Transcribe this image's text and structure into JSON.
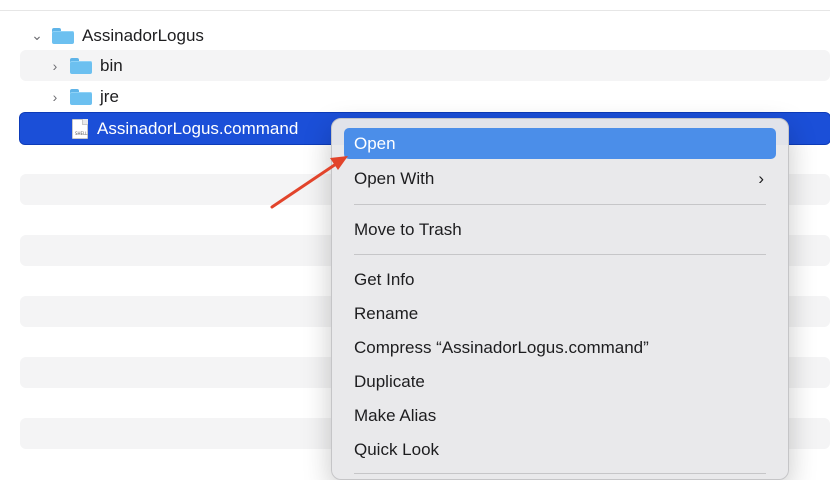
{
  "finder": {
    "root": {
      "name": "AssinadorLogus",
      "expanded": true
    },
    "items": [
      {
        "name": "bin",
        "kind": "folder"
      },
      {
        "name": "jre",
        "kind": "folder"
      },
      {
        "name": "AssinadorLogus.command",
        "kind": "file",
        "selected": true,
        "icon_tag": "SHELL"
      }
    ]
  },
  "context_menu": {
    "open": "Open",
    "open_with": "Open With",
    "open_with_chevron": "›",
    "move_to_trash": "Move to Trash",
    "get_info": "Get Info",
    "rename": "Rename",
    "compress": "Compress “AssinadorLogus.command”",
    "duplicate": "Duplicate",
    "make_alias": "Make Alias",
    "quick_look": "Quick Look"
  },
  "colors": {
    "selection": "#1b4fd8",
    "menu_highlight": "#4b8ee9",
    "annotation_arrow": "#e2442b"
  },
  "annotation": {
    "kind": "arrow",
    "points_to": "Open"
  }
}
